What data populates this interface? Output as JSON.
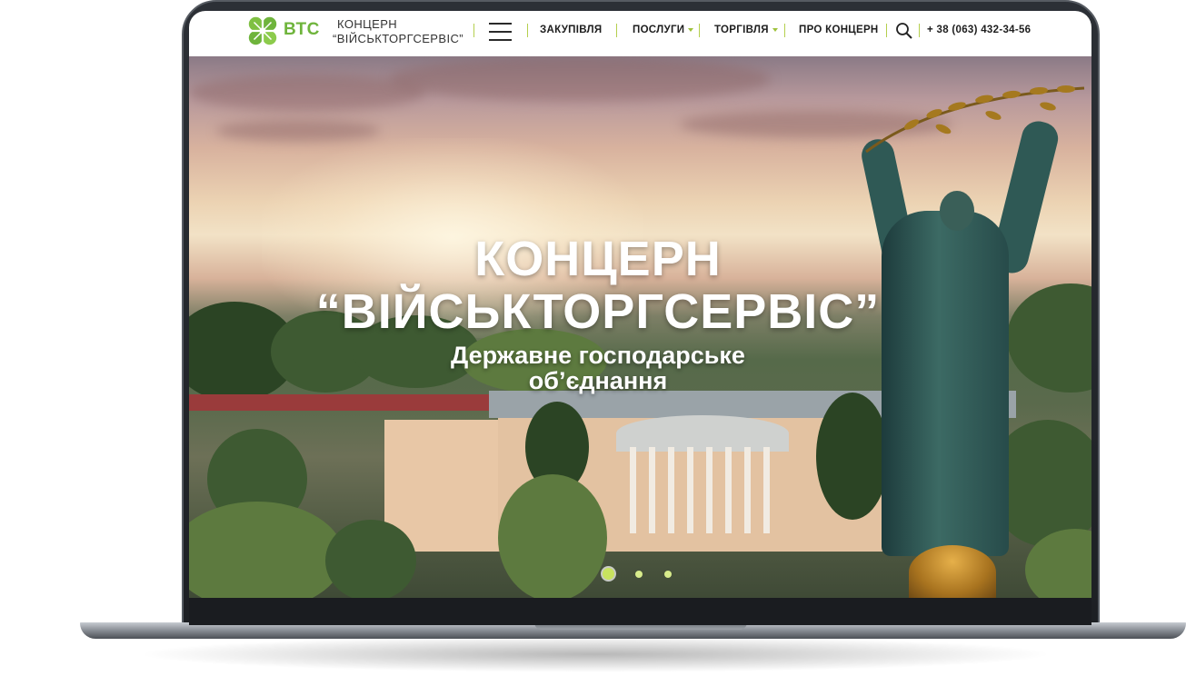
{
  "header": {
    "logo_abbr": "ВТС",
    "logo_line1": "КОНЦЕРН",
    "logo_line2": "“ВІЙСЬКТОРГСЕРВІС”",
    "nav": [
      {
        "label": "ЗАКУПІВЛЯ",
        "has_dropdown": false
      },
      {
        "label": "ПОСЛУГИ",
        "has_dropdown": true
      },
      {
        "label": "ТОРГІВЛЯ",
        "has_dropdown": true
      },
      {
        "label": "ПРО КОНЦЕРН",
        "has_dropdown": false
      }
    ],
    "phone": "+ 38 (063) 432-34-56",
    "icons": {
      "menu": "hamburger-menu-icon",
      "search": "search-icon",
      "logo": "clover-logo-icon"
    },
    "colors": {
      "brand_green": "#6fb43c",
      "accent_lime": "#b5cf4e"
    }
  },
  "hero": {
    "title_line1": "КОНЦЕРН",
    "title_line2": "“ВІЙСЬКТОРГСЕРВІС”",
    "subtitle_line1": "Державне господарське",
    "subtitle_line2": "об’єднання",
    "slider": {
      "total": 3,
      "active_index": 0
    }
  }
}
